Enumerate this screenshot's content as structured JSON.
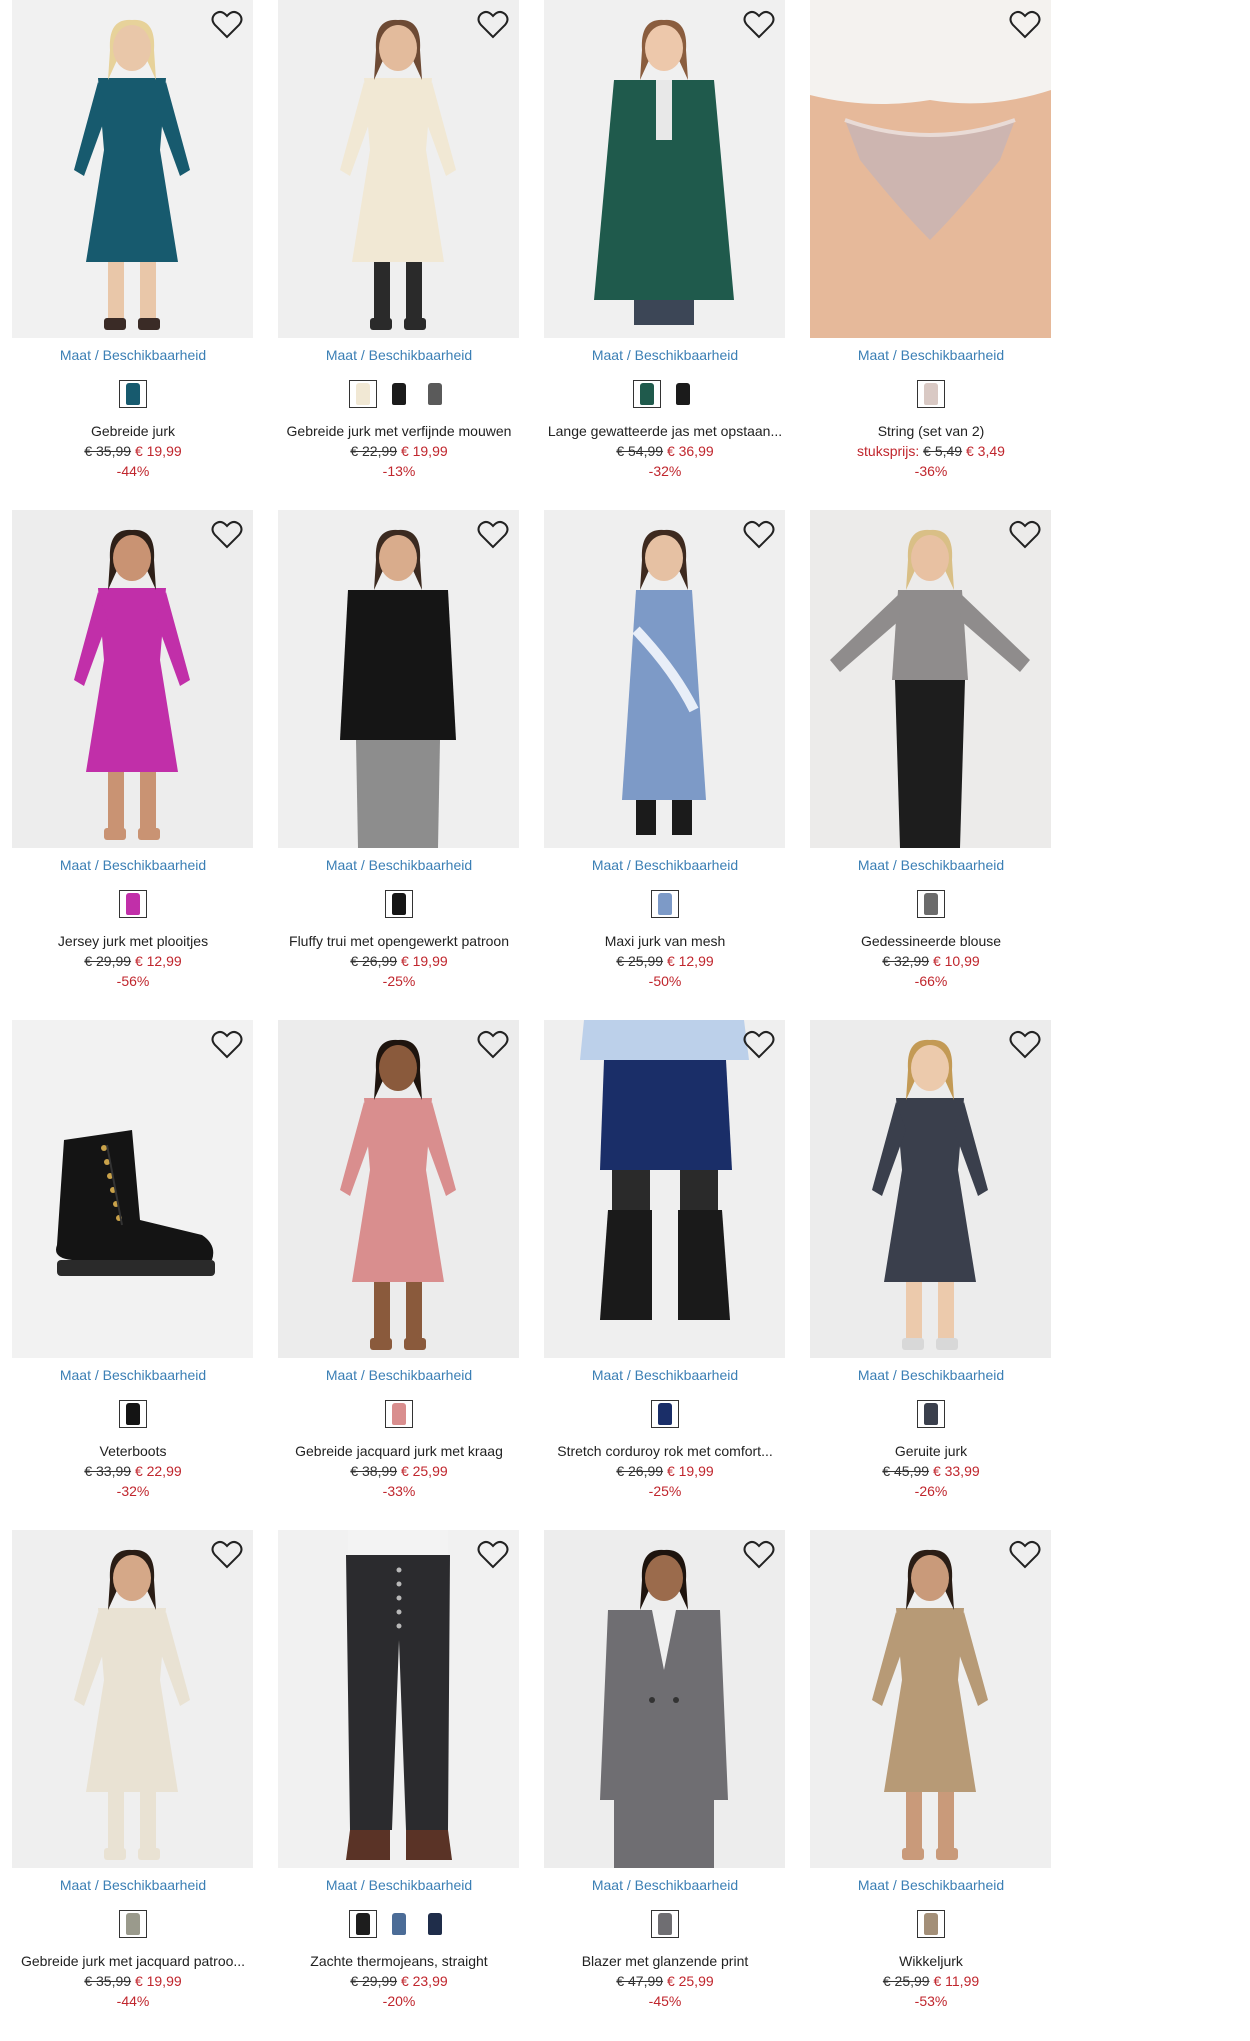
{
  "common": {
    "size_link": "Maat / Beschikbaarheid"
  },
  "products": [
    {
      "name": "Gebreide jurk",
      "old_price": "€ 35,99",
      "new_price": "€ 19,99",
      "discount": "-44%",
      "bg": "#f1f1f1",
      "skin": "#e9c7a9",
      "hair": "#e7d29a",
      "main": "#175a6e",
      "legs": "#e9c7a9",
      "shoes": "#3a2b26",
      "fig": "dress",
      "swatches": [
        "#175a6e"
      ]
    },
    {
      "name": "Gebreide jurk met verfijnde mouwen",
      "old_price": "€ 22,99",
      "new_price": "€ 19,99",
      "discount": "-13%",
      "bg": "#efefef",
      "skin": "#e3bb9c",
      "hair": "#6d4a34",
      "main": "#f1e8d4",
      "legs": "#2a2a2a",
      "shoes": "#2a2a2a",
      "fig": "dress",
      "swatches": [
        "#f1e8d4",
        "#1b1b1b",
        "#5a5a5a"
      ]
    },
    {
      "name": "Lange gewatteerde jas met opstaan...",
      "old_price": "€ 54,99",
      "new_price": "€ 36,99",
      "discount": "-32%",
      "bg": "#f0f0f0",
      "skin": "#edc8ab",
      "hair": "#8a5d3e",
      "main": "#1f5a4c",
      "legs": "#3c4656",
      "shoes": "#2a2a2a",
      "fig": "coat",
      "swatches": [
        "#1f5a4c",
        "#1b1b1b"
      ]
    },
    {
      "name": "String (set van 2)",
      "unit_label": "stuksprijs:",
      "old_price": "€ 5,49",
      "new_price": "€ 3,49",
      "discount": "-36%",
      "bg": "#e9e6e3",
      "skin": "#e6b99a",
      "hair": "#e6b99a",
      "main": "#cdb5b0",
      "legs": "#e6b99a",
      "shoes": "#e6b99a",
      "fig": "brief",
      "swatches": [
        "#d9c9c4"
      ]
    },
    {
      "name": "Jersey jurk met plooitjes",
      "old_price": "€ 29,99",
      "new_price": "€ 12,99",
      "discount": "-56%",
      "bg": "#ededed",
      "skin": "#c99373",
      "hair": "#2e2018",
      "main": "#c12fa9",
      "legs": "#c99373",
      "shoes": "#c99373",
      "fig": "dress",
      "swatches": [
        "#c12fa9"
      ]
    },
    {
      "name": "Fluffy trui met opengewerkt patroon",
      "old_price": "€ 26,99",
      "new_price": "€ 19,99",
      "discount": "-25%",
      "bg": "#efefef",
      "skin": "#d9ac8c",
      "hair": "#3b2a20",
      "main": "#151515",
      "legs": "#8d8d8d",
      "shoes": "#8d8d8d",
      "fig": "sweater",
      "swatches": [
        "#151515"
      ]
    },
    {
      "name": "Maxi jurk van mesh",
      "old_price": "€ 25,99",
      "new_price": "€ 12,99",
      "discount": "-50%",
      "bg": "#efefef",
      "skin": "#e6c1a3",
      "hair": "#3e2a1f",
      "main": "#7d9ac7",
      "legs": "#7d9ac7",
      "shoes": "#1b1b1b",
      "fig": "maxi",
      "swatches": [
        "#7d9ac7"
      ]
    },
    {
      "name": "Gedessineerde blouse",
      "old_price": "€ 32,99",
      "new_price": "€ 10,99",
      "discount": "-66%",
      "bg": "#ecebea",
      "skin": "#e8c1a2",
      "hair": "#d9bf86",
      "main": "#8f8c8c",
      "legs": "#1d1d1d",
      "shoes": "#1d1d1d",
      "fig": "blouse",
      "swatches": [
        "#6b6b6b"
      ]
    },
    {
      "name": "Veterboots",
      "old_price": "€ 33,99",
      "new_price": "€ 22,99",
      "discount": "-32%",
      "bg": "#f2f2f2",
      "skin": "#111",
      "hair": "#111",
      "main": "#141414",
      "legs": "#141414",
      "shoes": "#141414",
      "fig": "boot",
      "swatches": [
        "#141414"
      ]
    },
    {
      "name": "Gebreide jacquard jurk met kraag",
      "old_price": "€ 38,99",
      "new_price": "€ 25,99",
      "discount": "-33%",
      "bg": "#ececec",
      "skin": "#8a5a3c",
      "hair": "#1e140e",
      "main": "#d98e8e",
      "legs": "#8a5a3c",
      "shoes": "#8a5a3c",
      "fig": "dress",
      "swatches": [
        "#d98e8e"
      ]
    },
    {
      "name": "Stretch corduroy rok met comfort...",
      "old_price": "€ 26,99",
      "new_price": "€ 19,99",
      "discount": "-25%",
      "bg": "#efefef",
      "skin": "#e7c3a6",
      "hair": "#e7c3a6",
      "main": "#1a2e68",
      "legs": "#2a2a2a",
      "shoes": "#1a1a1a",
      "fig": "skirt",
      "swatches": [
        "#1a2e68"
      ]
    },
    {
      "name": "Geruite jurk",
      "old_price": "€ 45,99",
      "new_price": "€ 33,99",
      "discount": "-26%",
      "bg": "#ececec",
      "skin": "#eccaac",
      "hair": "#c39a55",
      "main": "#3a3f4c",
      "legs": "#eccaac",
      "shoes": "#d8d8d8",
      "fig": "dress",
      "swatches": [
        "#3a3f4c"
      ]
    },
    {
      "name": "Gebreide jurk met jacquard patroo...",
      "old_price": "€ 35,99",
      "new_price": "€ 19,99",
      "discount": "-44%",
      "bg": "#efefef",
      "skin": "#d5a888",
      "hair": "#2a1d15",
      "main": "#e9e2d3",
      "legs": "#e9e2d3",
      "shoes": "#e9e2d3",
      "fig": "dress",
      "swatches": [
        "#9a9a8c"
      ]
    },
    {
      "name": "Zachte thermojeans, straight",
      "old_price": "€ 29,99",
      "new_price": "€ 23,99",
      "discount": "-20%",
      "bg": "#f1f1f1",
      "skin": "#f1f1f1",
      "hair": "#f1f1f1",
      "main": "#f3f3f3",
      "legs": "#2b2b2e",
      "shoes": "#5a3326",
      "fig": "jeans",
      "swatches": [
        "#1d1d1d",
        "#4b6c97",
        "#1f2d4a"
      ]
    },
    {
      "name": "Blazer met glanzende print",
      "old_price": "€ 47,99",
      "new_price": "€ 25,99",
      "discount": "-45%",
      "bg": "#ededed",
      "skin": "#9b6b4c",
      "hair": "#1e140e",
      "main": "#6f6e72",
      "legs": "#6f6e72",
      "shoes": "#6f6e72",
      "fig": "blazer",
      "swatches": [
        "#6f6e72"
      ]
    },
    {
      "name": "Wikkeljurk",
      "old_price": "€ 25,99",
      "new_price": "€ 11,99",
      "discount": "-53%",
      "bg": "#efefef",
      "skin": "#c99a7a",
      "hair": "#2a1d15",
      "main": "#b79a76",
      "legs": "#c99a7a",
      "shoes": "#c99a7a",
      "fig": "dress",
      "swatches": [
        "#a38f78"
      ]
    }
  ]
}
